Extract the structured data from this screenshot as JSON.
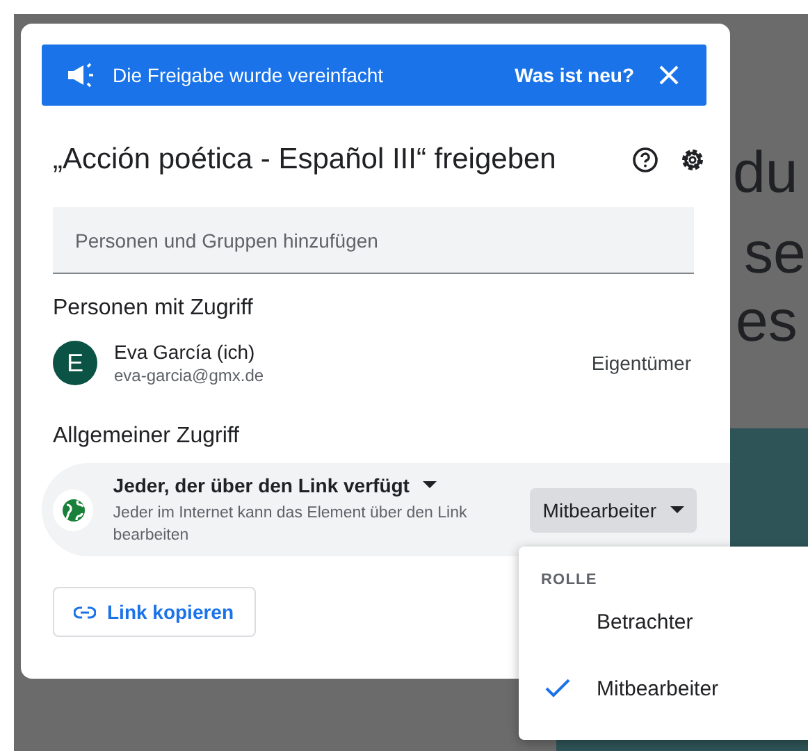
{
  "background": {
    "fragments": [
      "du",
      "se",
      "es"
    ]
  },
  "banner": {
    "text": "Die Freigabe wurde vereinfacht",
    "link": "Was ist neu?"
  },
  "dialog": {
    "title": "„Acción poética - Español III“ freigeben",
    "add_field": {
      "placeholder": "Personen und Gruppen hinzufügen"
    },
    "people_heading": "Personen mit Zugriff",
    "people": [
      {
        "initial": "E",
        "name": "Eva García (ich)",
        "email": "eva-garcia@gmx.de",
        "role": "Eigentümer",
        "color": "#0b5345"
      }
    ],
    "general_heading": "Allgemeiner Zugriff",
    "general": {
      "scope": "Jeder, der über den Link verfügt",
      "description": "Jeder im Internet kann das Element über den Link bearbeiten",
      "role": "Mitbearbeiter"
    },
    "copy_link": "Link kopieren"
  },
  "role_menu": {
    "heading": "ROLLE",
    "items": [
      {
        "label": "Betrachter",
        "selected": false
      },
      {
        "label": "Mitbearbeiter",
        "selected": true
      }
    ]
  }
}
